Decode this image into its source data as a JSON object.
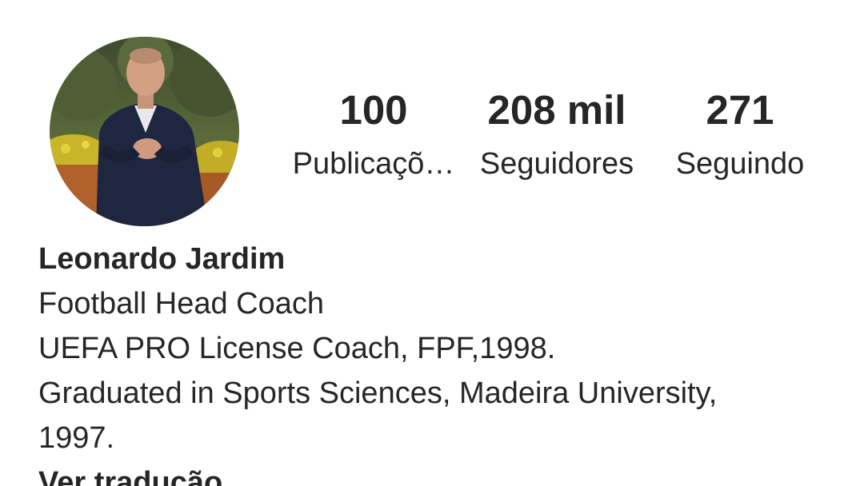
{
  "profile": {
    "avatar_alt": "Leonardo Jardim profile photo",
    "stats": [
      {
        "value": "100",
        "label": "Publicaçõ…"
      },
      {
        "value": "208 mil",
        "label": "Seguidores"
      },
      {
        "value": "271",
        "label": "Seguindo"
      }
    ],
    "name": "Leonardo Jardim",
    "bio_lines": [
      "Football Head Coach",
      "UEFA PRO License Coach, FPF,1998.",
      "Graduated in Sports Sciences, Madeira University,",
      "1997."
    ],
    "translate_link": "Ver tradução"
  },
  "colors": {
    "text": "#262626",
    "background": "#ffffff"
  }
}
